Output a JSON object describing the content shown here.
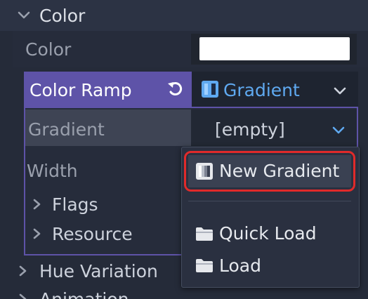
{
  "inspector": {
    "color_section": {
      "label": "Color"
    },
    "color_row": {
      "label": "Color",
      "value_color": "#ffffff"
    },
    "color_ramp_row": {
      "label": "Color Ramp",
      "resource_type": "Gradient"
    },
    "gradient_row": {
      "label": "Gradient",
      "value": "[empty]"
    },
    "width_row": {
      "label": "Width"
    },
    "flags_section": {
      "label": "Flags"
    },
    "resource_section": {
      "label": "Resource"
    },
    "hue_variation_section": {
      "label": "Hue Variation"
    },
    "animation_section": {
      "label": "Animation"
    }
  },
  "dropdown_menu": {
    "items": [
      {
        "label": "New Gradient",
        "icon": "gradient-icon",
        "highlighted": true
      },
      {
        "label": "Quick Load",
        "icon": "folder-icon"
      },
      {
        "label": "Load",
        "icon": "folder-icon"
      }
    ]
  },
  "colors": {
    "accent_purple": "#5e53a8",
    "accent_blue": "#5fa9f0",
    "highlight_red": "#e02a2a",
    "background": "#252b39"
  }
}
